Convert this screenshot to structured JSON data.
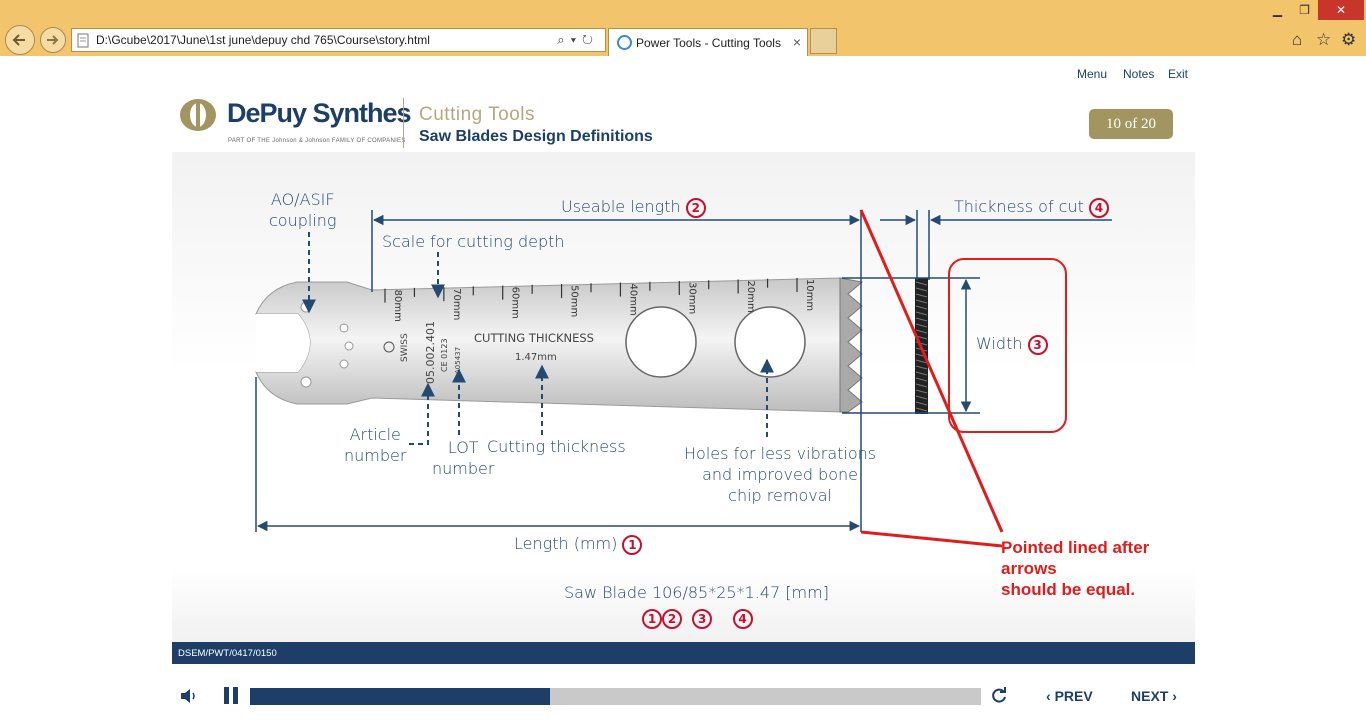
{
  "browser": {
    "address": "D:\\Gcube\\2017\\June\\1st june\\depuy chd 765\\Course\\story.html",
    "tab_title": "Power Tools - Cutting Tools",
    "tab_close": "×",
    "window_controls": [
      "minimize-icon",
      "restore-icon",
      "close-icon"
    ],
    "toolbar_icons": [
      "home-icon",
      "favorites-star-icon",
      "settings-gear-icon"
    ]
  },
  "course_nav": {
    "menu": "Menu",
    "notes": "Notes",
    "exit": "Exit"
  },
  "header": {
    "logo": "DePuy Synthes",
    "logo_tagline": "PART OF THE Johnson & Johnson FAMILY OF COMPANIES",
    "module_title": "Cutting Tools",
    "slide_title": "Saw Blades Design Definitions",
    "slide_counter": "10 of 20"
  },
  "diagram": {
    "labels": {
      "coupling_line1": "AO/ASIF",
      "coupling_line2": "coupling",
      "useable_length": "Useable length",
      "scale": "Scale for cutting depth",
      "thickness_of_cut": "Thickness of cut",
      "width": "Width",
      "article_line1": "Article",
      "article_line2": "number",
      "lot_line1": "LOT",
      "lot_line2": "number",
      "cutting_thickness": "Cutting thickness",
      "holes_line1": "Holes for less vibrations",
      "holes_line2": "and improved bone",
      "holes_line3": "chip removal",
      "length": "Length (mm)",
      "blade_spec": "Saw Blade 106/85*25*1.47 [mm]"
    },
    "markers": {
      "length": "1",
      "useable_length": "2",
      "width": "3",
      "thickness_of_cut": "4"
    },
    "blade_text": {
      "swiss": "SWISS",
      "article_no": "05.002.401",
      "ce": "CE 0123",
      "lot": "A05437",
      "cutting_thickness": "CUTTING THICKNESS",
      "thickness_value": "1.47mm",
      "scale_ticks": [
        "80mm",
        "70mm",
        "60mm",
        "50mm",
        "40mm",
        "30mm",
        "20mm",
        "10mm"
      ]
    },
    "annotation_line1": "Pointed lined after arrows",
    "annotation_line2": "should be equal."
  },
  "footer": {
    "code": "DSEM/PWT/0417/0150"
  },
  "player": {
    "progress_fraction": 0.41,
    "prev": "PREV",
    "next": "NEXT",
    "icons": [
      "volume-icon",
      "pause-icon",
      "replay-icon",
      "prev-chevron-icon",
      "next-chevron-icon"
    ]
  },
  "colors": {
    "navy": "#1d3f67",
    "gold": "#b5a77e",
    "red": "#e11c1c",
    "badge": "#a2955f"
  }
}
